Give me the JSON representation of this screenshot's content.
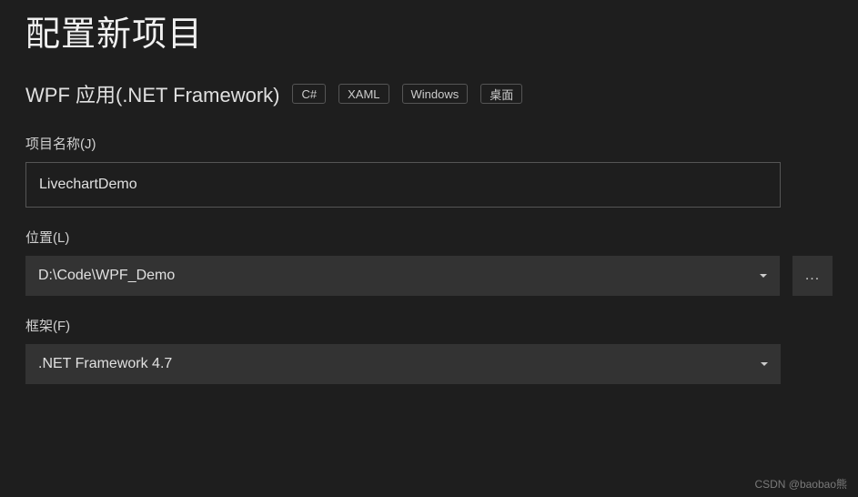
{
  "page_title": "配置新项目",
  "subtitle": "WPF 应用(.NET Framework)",
  "tags": [
    "C#",
    "XAML",
    "Windows",
    "桌面"
  ],
  "fields": {
    "project_name": {
      "label": "项目名称(J)",
      "value": "LivechartDemo"
    },
    "location": {
      "label": "位置(L)",
      "value": "D:\\Code\\WPF_Demo",
      "browse": "..."
    },
    "framework": {
      "label": "框架(F)",
      "value": ".NET Framework 4.7"
    }
  },
  "watermark": "CSDN @baobao熊"
}
